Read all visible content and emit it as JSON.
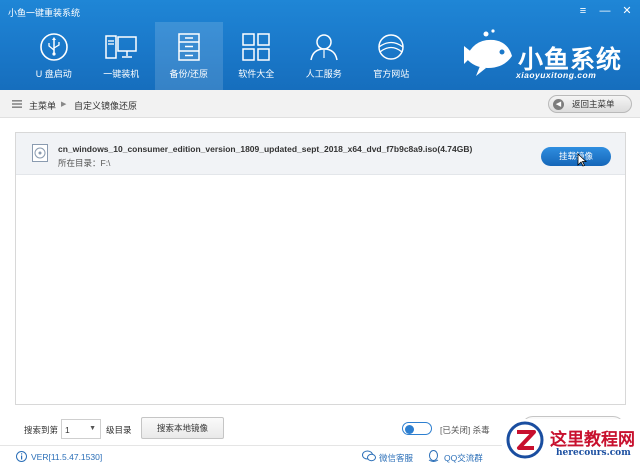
{
  "window": {
    "title": "小鱼一键重装系统",
    "controls": [
      "≡",
      "—",
      "✕"
    ]
  },
  "nav": [
    {
      "label": "U 盘启动",
      "icon": "usb-icon"
    },
    {
      "label": "一键装机",
      "icon": "monitor-icon"
    },
    {
      "label": "备份/还原",
      "icon": "archive-icon",
      "active": true
    },
    {
      "label": "软件大全",
      "icon": "grid-icon"
    },
    {
      "label": "人工服务",
      "icon": "user-icon"
    },
    {
      "label": "官方网站",
      "icon": "planet-icon"
    }
  ],
  "logo": {
    "text": "小鱼系统",
    "url": "xiaoyuxitong.com"
  },
  "breadcrumb": {
    "home": "主菜单",
    "current": "自定义镜像还原",
    "back_label": "返回主菜单"
  },
  "file": {
    "name": "cn_windows_10_consumer_edition_version_1809_updated_sept_2018_x64_dvd_f7b9c8a9.iso(4.74GB)",
    "dir": "所在目录：F:\\",
    "mount_label": "挂载镜像"
  },
  "bottom": {
    "search_to": "搜索到第",
    "level_value": "1",
    "level_suffix": "级目录",
    "search_local": "搜索本地镜像",
    "toggle_status": "[已关闭] 杀毒"
  },
  "status": {
    "version": "VER[11.5.47.1530]",
    "wechat": "微信客服",
    "qq": "QQ交流群"
  },
  "watermark": {
    "title": "这里教程网",
    "url": "herecours.com"
  },
  "colors": {
    "header": "#1a78c9",
    "accent": "#1666b8",
    "watermark_red": "#c8102e"
  }
}
